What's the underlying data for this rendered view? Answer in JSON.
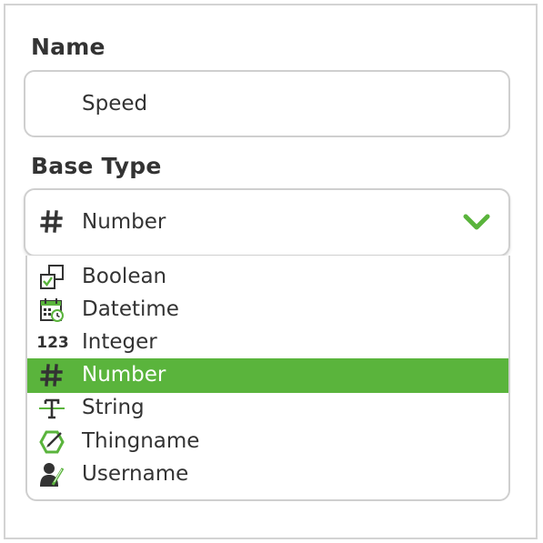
{
  "form": {
    "name_label": "Name",
    "name_value": "Speed",
    "base_type_label": "Base Type",
    "selected_type": "Number"
  },
  "options": [
    {
      "label": "Boolean",
      "icon": "boolean-icon"
    },
    {
      "label": "Datetime",
      "icon": "calendar-icon"
    },
    {
      "label": "Integer",
      "icon": "integer-123-icon",
      "icon_text": "123"
    },
    {
      "label": "Number",
      "icon": "hash-icon",
      "selected": true
    },
    {
      "label": "String",
      "icon": "text-t-icon"
    },
    {
      "label": "Thingname",
      "icon": "thingname-icon"
    },
    {
      "label": "Username",
      "icon": "user-pen-icon"
    }
  ],
  "colors": {
    "accent": "#5ab43c",
    "text": "#333333",
    "border": "#cfcfcf"
  }
}
